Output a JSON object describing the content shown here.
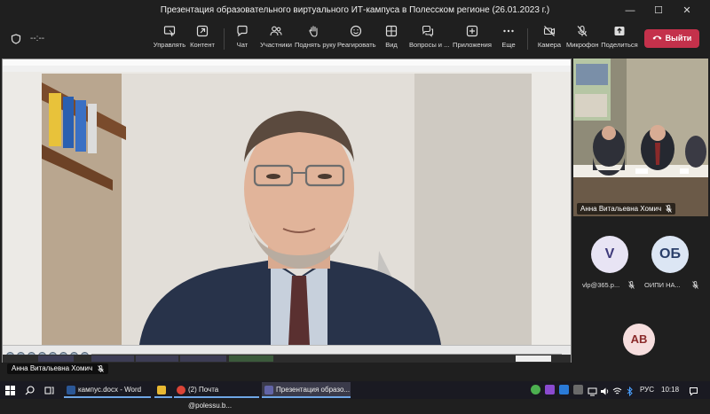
{
  "window": {
    "title": "Презентация образовательного виртуального ИТ-кампуса в Полесском регионе (26.01.2023 г.)",
    "minimize": "—",
    "maximize": "☐",
    "close": "✕"
  },
  "toolbar": {
    "timer": "--:--",
    "buttons": [
      {
        "label": "Управлять",
        "icon": "control-icon"
      },
      {
        "label": "Контент",
        "icon": "share-content-icon"
      },
      {
        "label": "Чат",
        "icon": "chat-icon"
      },
      {
        "label": "Участники",
        "icon": "participants-icon"
      },
      {
        "label": "Поднять руку",
        "icon": "raise-hand-icon"
      },
      {
        "label": "Реагировать",
        "icon": "react-icon"
      },
      {
        "label": "Вид",
        "icon": "view-icon"
      },
      {
        "label": "Вопросы и ...",
        "icon": "qa-icon"
      },
      {
        "label": "Приложения",
        "icon": "apps-icon"
      },
      {
        "label": "Еще",
        "icon": "more-icon"
      },
      {
        "label": "Камера",
        "icon": "camera-off-icon"
      },
      {
        "label": "Микрофон",
        "icon": "mic-off-icon"
      },
      {
        "label": "Поделиться",
        "icon": "share-icon"
      }
    ],
    "leave_label": "Выйти"
  },
  "stage": {
    "presenter_name": "Анна Витальевна Хомич"
  },
  "panel": {
    "tile_name": "Анна Витальевна Хомич",
    "participants": [
      {
        "initials": "V",
        "name": "vlp@365.p..."
      },
      {
        "initials": "ОБ",
        "name": "ОИПИ НА..."
      },
      {
        "initials": "АВ",
        "name": ""
      }
    ]
  },
  "taskbar": {
    "apps": [
      {
        "label": "кампус.docx - Word"
      },
      {
        "label": ""
      },
      {
        "label": "(2) Почта @polessu.b..."
      },
      {
        "label": "Презентация образо..."
      }
    ],
    "language": "РУС",
    "time": "10:18"
  },
  "colors": {
    "leave": "#c4314b",
    "avatar_v": "#e8e4f4",
    "avatar_ob": "#dce6f4",
    "avatar_av": "#f6dede"
  }
}
